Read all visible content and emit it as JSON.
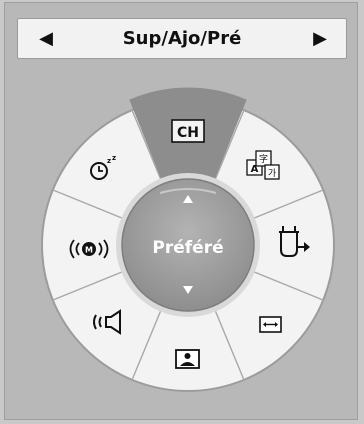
{
  "header": {
    "title": "Sup/Ajo/Pré",
    "prev_icon": "triangle-left",
    "next_icon": "triangle-right"
  },
  "wheel": {
    "center_label": "Préféré",
    "up_icon": "triangle-up",
    "down_icon": "triangle-down",
    "selected_segment": "ch",
    "segments": [
      {
        "id": "ch",
        "label": "CH",
        "icon": "channel-box-icon"
      },
      {
        "id": "language",
        "label": "",
        "icon": "language-characters-icon"
      },
      {
        "id": "input",
        "label": "",
        "icon": "input-source-icon"
      },
      {
        "id": "aspect",
        "label": "",
        "icon": "aspect-ratio-icon"
      },
      {
        "id": "picture",
        "label": "",
        "icon": "picture-mode-icon"
      },
      {
        "id": "sound",
        "label": "",
        "icon": "sound-mode-icon"
      },
      {
        "id": "multiaudio",
        "label": "",
        "icon": "multi-audio-icon"
      },
      {
        "id": "sleep",
        "label": "",
        "icon": "sleep-timer-icon"
      }
    ]
  },
  "colors": {
    "background": "#b8b8b8",
    "wheel": "#f0f0f0",
    "selected": "#8e8e8e",
    "center": "#9a9a9a"
  }
}
